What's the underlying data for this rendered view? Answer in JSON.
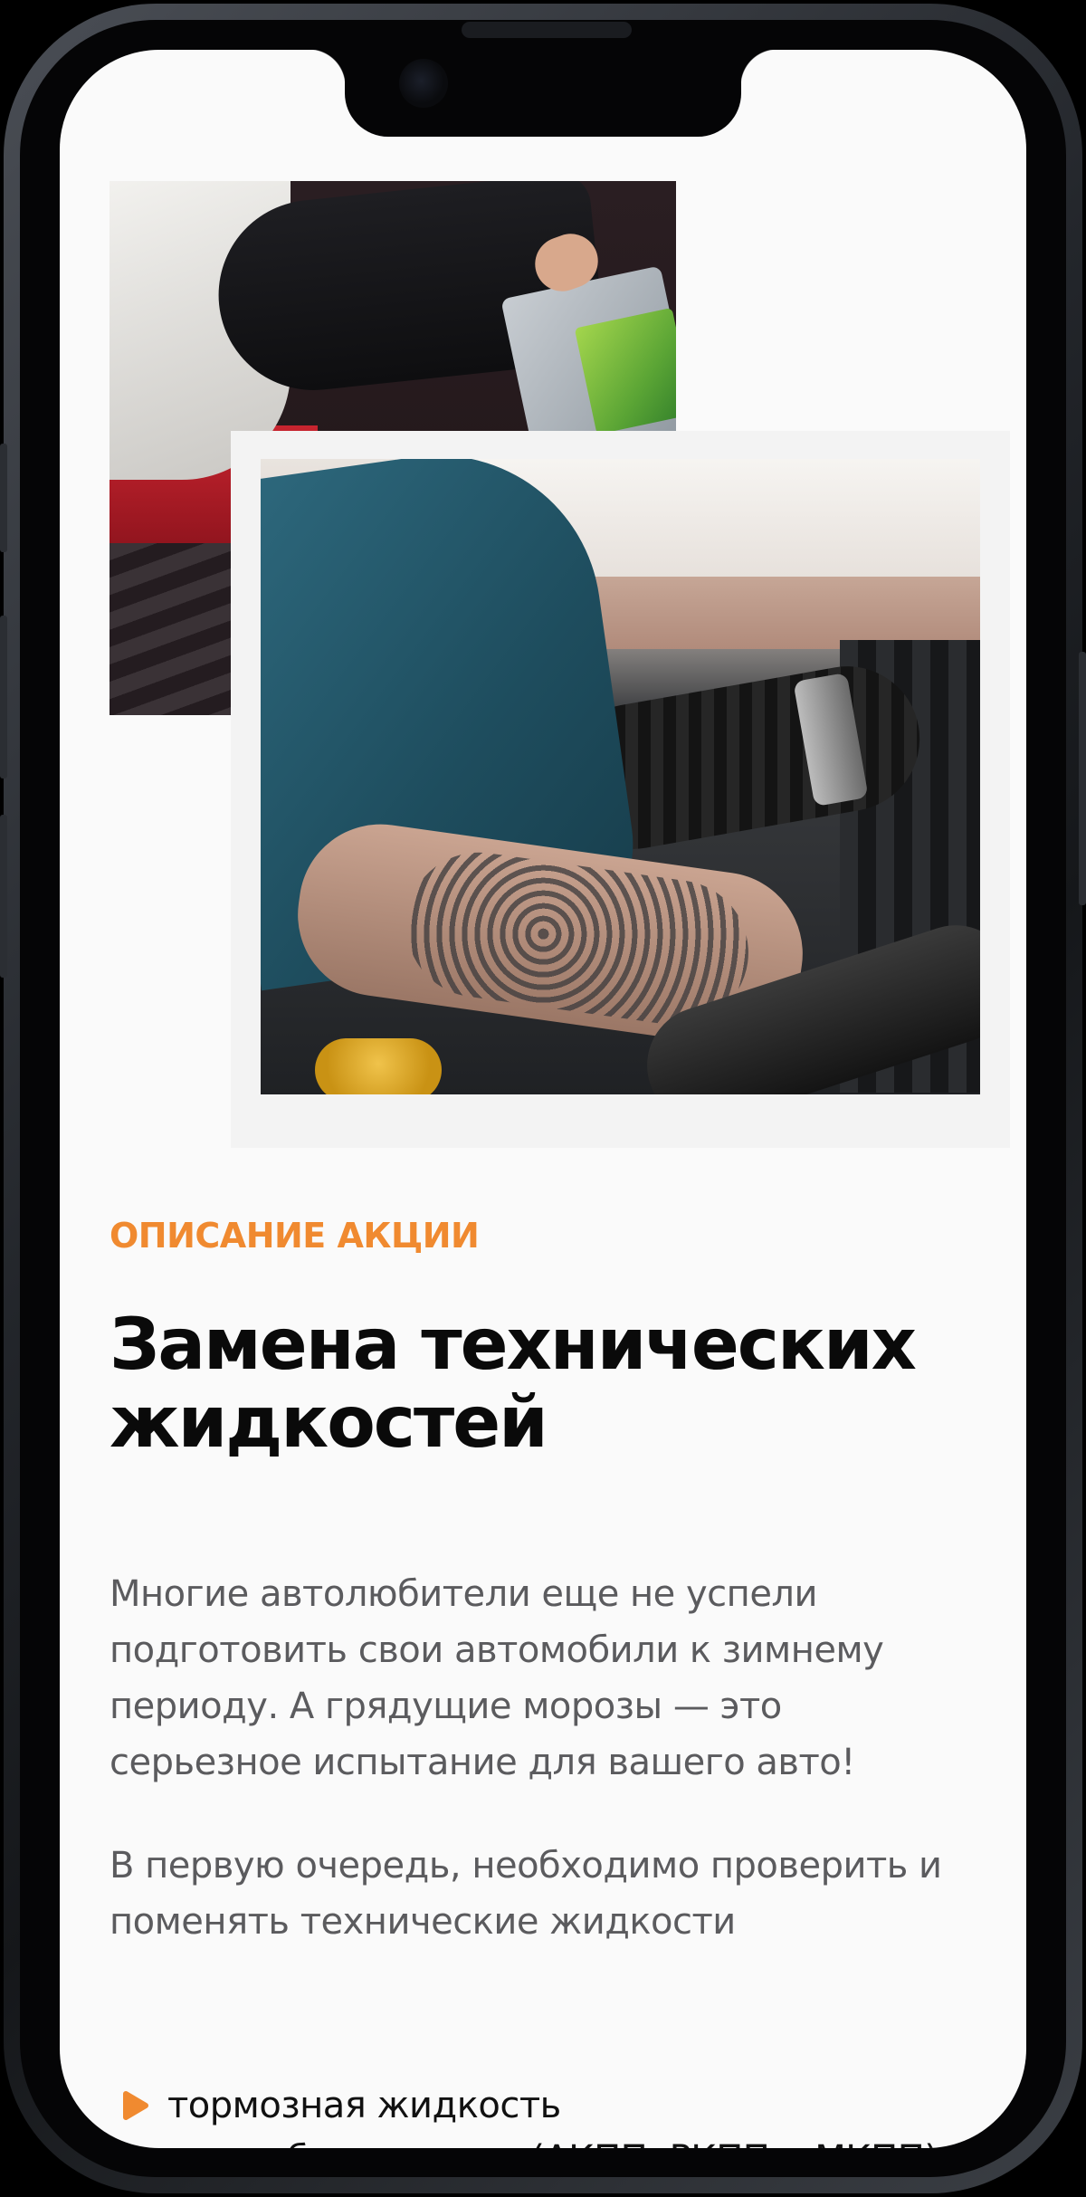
{
  "promo": {
    "eyebrow": "ОПИСАНИЕ АКЦИИ",
    "title": "Замена технических жидкостей",
    "paragraph_1": "Многие автолюбители еще не успели подготовить свои автомобили к зимнему периоду. А грядущие морозы — это серьезное испытание для вашего авто!",
    "paragraph_2": "В первую очередь, необходимо проверить и поменять технические жидкости"
  },
  "list": {
    "items": [
      {
        "label": "тормозная жидкость"
      },
      {
        "label": "в коробке передач (АКПП, РКПП и МКПП)"
      }
    ]
  },
  "colors": {
    "accent": "#f08a30",
    "background": "#fafafa",
    "text_primary": "#0a0a0a",
    "text_secondary": "#5b5b5e"
  },
  "icons": {
    "bullet": "play-triangle-icon"
  }
}
